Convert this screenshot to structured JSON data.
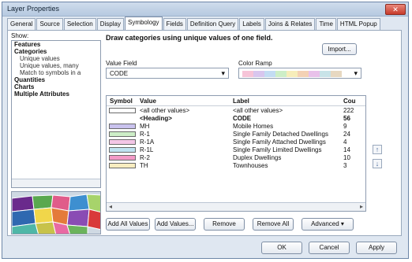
{
  "window": {
    "title": "Layer Properties",
    "close_glyph": "✕"
  },
  "tabs": [
    "General",
    "Source",
    "Selection",
    "Display",
    "Symbology",
    "Fields",
    "Definition Query",
    "Labels",
    "Joins & Relates",
    "Time",
    "HTML Popup"
  ],
  "active_tab_index": 4,
  "show": {
    "label": "Show:",
    "items": [
      {
        "text": "Features",
        "type": "bold"
      },
      {
        "text": "Categories",
        "type": "bold"
      },
      {
        "text": "Unique values",
        "type": "sub"
      },
      {
        "text": "Unique values, many",
        "type": "sub"
      },
      {
        "text": "Match to symbols in a",
        "type": "sub"
      },
      {
        "text": "Quantities",
        "type": "bold"
      },
      {
        "text": "Charts",
        "type": "bold"
      },
      {
        "text": "Multiple Attributes",
        "type": "bold"
      }
    ]
  },
  "main": {
    "heading": "Draw categories using unique values of one field.",
    "import_label": "Import...",
    "value_field_label": "Value Field",
    "value_field_value": "CODE",
    "color_ramp_label": "Color Ramp",
    "ramp_colors": [
      "#f6c4d8",
      "#d8c6ee",
      "#c3dcf3",
      "#cdeec7",
      "#f6edba",
      "#f3d1b4",
      "#e8c1ea",
      "#c8e3e8",
      "#e7d8c1"
    ]
  },
  "grid": {
    "headers": {
      "symbol": "Symbol",
      "value": "Value",
      "label": "Label",
      "count": "Cou"
    },
    "rows": [
      {
        "swatch": "#ffffff",
        "value": "<all other values>",
        "label": "<all other values>",
        "count": "222",
        "bold": false
      },
      {
        "swatch": "",
        "value": "<Heading>",
        "label": "CODE",
        "count": "56",
        "bold": true
      },
      {
        "swatch": "#c9c2ee",
        "value": "MH",
        "label": "Mobile Homes",
        "count": "9",
        "bold": false
      },
      {
        "swatch": "#cdeec7",
        "value": "R-1",
        "label": "Single Family Detached Dwellings",
        "count": "24",
        "bold": false
      },
      {
        "swatch": "#f3c6e6",
        "value": "R-1A",
        "label": "Single Family Attached Dwellings",
        "count": "4",
        "bold": false
      },
      {
        "swatch": "#bfe3f1",
        "value": "R-1L",
        "label": "Single Family Limited Dwellings",
        "count": "14",
        "bold": false
      },
      {
        "swatch": "#f39ac7",
        "value": "R-2",
        "label": "Duplex Dwellings",
        "count": "10",
        "bold": false
      },
      {
        "swatch": "#f8edc0",
        "value": "TH",
        "label": "Townhouses",
        "count": "3",
        "bold": false
      }
    ]
  },
  "buttons": {
    "add_all": "Add All Values",
    "add": "Add Values...",
    "remove": "Remove",
    "remove_all": "Remove All",
    "advanced": "Advanced"
  },
  "footer": {
    "ok": "OK",
    "cancel": "Cancel",
    "apply": "Apply"
  },
  "glyphs": {
    "dropdown": "▾",
    "up": "↑",
    "down": "↓",
    "left": "◂",
    "right": "▸"
  }
}
